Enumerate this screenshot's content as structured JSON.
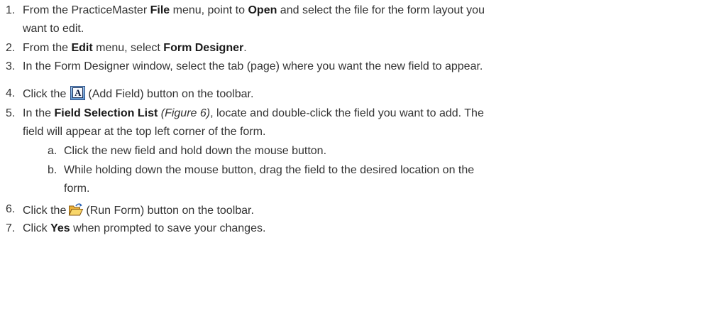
{
  "steps": [
    {
      "number": "1.",
      "line1": {
        "t1": "From the PracticeMaster ",
        "b1": "File",
        "t2": " menu, point to ",
        "b2": "Open",
        "t3": " and select the file for the form layout you"
      },
      "line2": "want to edit."
    },
    {
      "number": "2.",
      "t1": "From the ",
      "b1": "Edit",
      "t2": " menu, select ",
      "b2": "Form Designer",
      "t3": "."
    },
    {
      "number": "3.",
      "text": "In the Form Designer window, select the tab (page) where you want the new field to appear."
    },
    {
      "number": "4.",
      "t1": "Click the",
      "icon": "add-field-icon",
      "icon_letter": "A",
      "t2": "(Add Field) button on the toolbar."
    },
    {
      "number": "5.",
      "line1": {
        "t1": "In the ",
        "b1": "Field Selection List",
        "t2": " ",
        "i1": "(Figure 6)",
        "t3": ", locate and double-click the field you want to add. The"
      },
      "line2": "field will appear at the top left corner of the form.",
      "substeps": [
        {
          "letter": "a.",
          "text": "Click the new field and hold down the mouse button."
        },
        {
          "letter": "b.",
          "line1": "While holding down the mouse button, drag the field to the desired location on the",
          "line2": "form."
        }
      ]
    },
    {
      "number": "6.",
      "t1": "Click the",
      "icon": "open-folder-icon",
      "t2": "(Run Form) button on the toolbar."
    },
    {
      "number": "7.",
      "t1": "Click ",
      "b1": "Yes",
      "t2": " when prompted to save your changes."
    }
  ]
}
